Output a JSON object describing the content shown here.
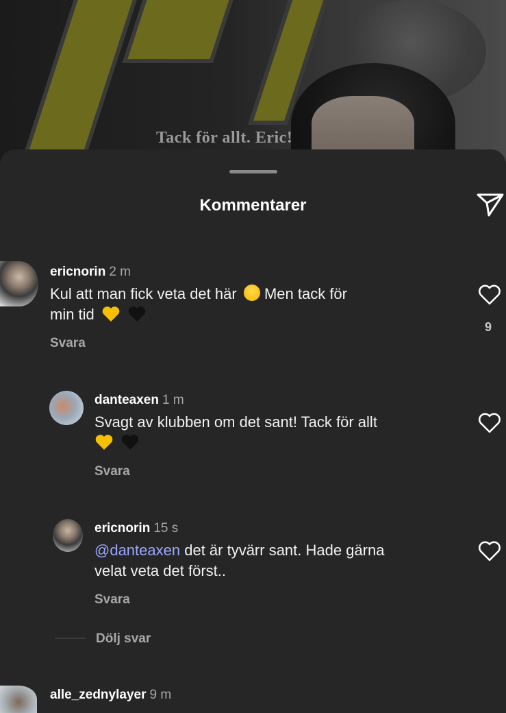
{
  "hero": {
    "caption": "Tack för allt. Eric!"
  },
  "header": {
    "title": "Kommentarer",
    "share_icon": "send-icon"
  },
  "comments": [
    {
      "user": "ericnorin",
      "time": "2 m",
      "text": "Kul att man fick veta det här",
      "text2": "Men tack för",
      "text3": "min tid",
      "reply": "Svara",
      "likes": "9"
    },
    {
      "user": "danteaxen",
      "time": "1 m",
      "text": "Svagt av klubben om det sant! Tack för allt",
      "reply": "Svara"
    },
    {
      "user": "ericnorin",
      "time": "15 s",
      "mention": "@danteaxen",
      "text": "det är tyvärr sant. Hade gärna",
      "text2": "velat veta det först..",
      "reply": "Svara"
    },
    {
      "user": "alle_zednylayer",
      "time": "9 m"
    }
  ],
  "hide_replies": "Dölj svar",
  "colors": {
    "background": "#262626",
    "mention": "#9aa6ff",
    "muted": "#a8a8a8"
  }
}
